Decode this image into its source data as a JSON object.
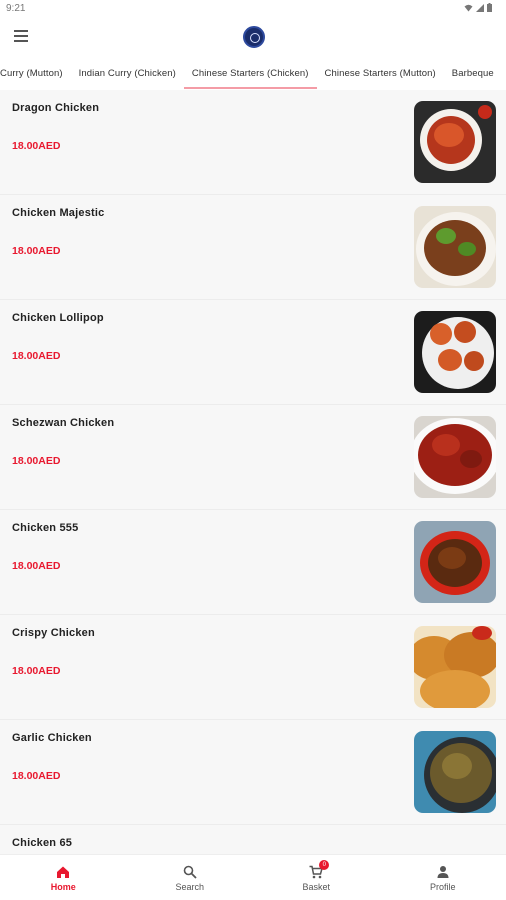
{
  "status_bar": {
    "time": "9:21"
  },
  "header": {
    "logo_icon": "restaurant-logo"
  },
  "tabs": [
    {
      "label": "Curry (Mutton)",
      "active": false
    },
    {
      "label": "Indian Curry (Chicken)",
      "active": false
    },
    {
      "label": "Chinese Starters (Chicken)",
      "active": true
    },
    {
      "label": "Chinese Starters (Mutton)",
      "active": false
    },
    {
      "label": "Barbeque",
      "active": false
    }
  ],
  "items": [
    {
      "name": "Dragon Chicken",
      "price": "18.00AED"
    },
    {
      "name": "Chicken Majestic",
      "price": "18.00AED"
    },
    {
      "name": "Chicken Lollipop",
      "price": "18.00AED"
    },
    {
      "name": "Schezwan Chicken",
      "price": "18.00AED"
    },
    {
      "name": "Chicken 555",
      "price": "18.00AED"
    },
    {
      "name": "Crispy Chicken",
      "price": "18.00AED"
    },
    {
      "name": "Garlic Chicken",
      "price": "18.00AED"
    },
    {
      "name": "Chicken 65",
      "price": ""
    }
  ],
  "bottom_nav": {
    "home": "Home",
    "search": "Search",
    "basket": "Basket",
    "basket_count": "0",
    "profile": "Profile"
  },
  "colors": {
    "accent": "#e8182f",
    "tab_indicator": "#f49ca6"
  }
}
